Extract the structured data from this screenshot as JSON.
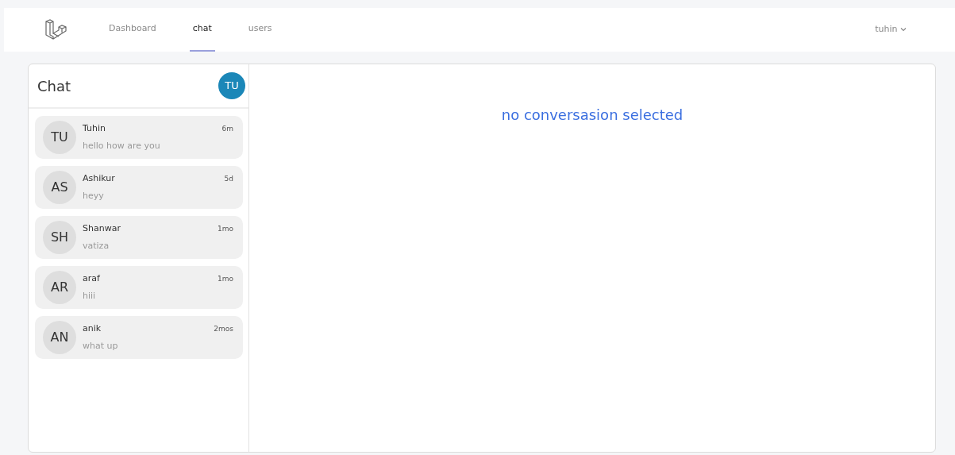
{
  "nav": {
    "links": [
      {
        "label": "Dashboard",
        "selected": false
      },
      {
        "label": "chat",
        "selected": true
      },
      {
        "label": "users",
        "selected": false
      }
    ],
    "user": "tuhin"
  },
  "sidebar": {
    "title": "Chat",
    "avatar": "TU",
    "conversations": [
      {
        "initials": "TU",
        "name": "Tuhin",
        "time": "6m",
        "message": "hello how are you"
      },
      {
        "initials": "AS",
        "name": "Ashikur",
        "time": "5d",
        "message": "heyy"
      },
      {
        "initials": "SH",
        "name": "Shanwar",
        "time": "1mo",
        "message": "vatiza"
      },
      {
        "initials": "AR",
        "name": "araf",
        "time": "1mo",
        "message": "hiii"
      },
      {
        "initials": "AN",
        "name": "anik",
        "time": "2mos",
        "message": "what up"
      }
    ]
  },
  "main": {
    "empty_message": "no conversasion selected"
  }
}
